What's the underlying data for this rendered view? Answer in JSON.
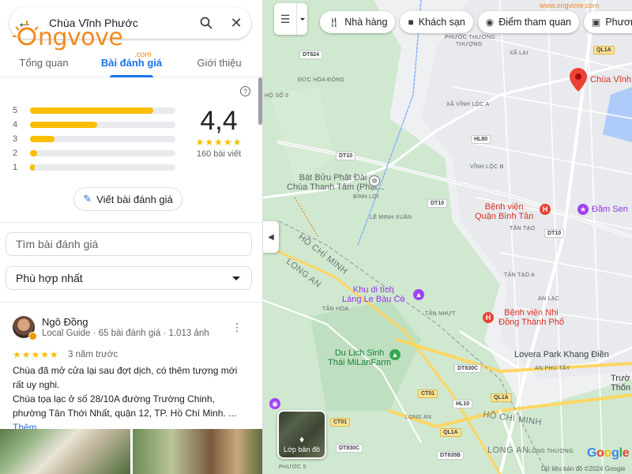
{
  "search": {
    "query": "Chùa Vĩnh Phước"
  },
  "watermark": {
    "text": "ngvove",
    "suffix": ".com",
    "map_site": "www.ongvove.com"
  },
  "tabs": [
    {
      "label": "Tổng quan"
    },
    {
      "label": "Bài đánh giá"
    },
    {
      "label": "Giới thiệu"
    }
  ],
  "rating": {
    "score": "4,4",
    "count": "160 bài viết",
    "stars": "★★★★★",
    "bars": [
      {
        "label": "5",
        "fraction": 0.85
      },
      {
        "label": "4",
        "fraction": 0.46
      },
      {
        "label": "3",
        "fraction": 0.17
      },
      {
        "label": "2",
        "fraction": 0.05
      },
      {
        "label": "1",
        "fraction": 0.03
      }
    ],
    "write_label": "Viết bài đánh giá"
  },
  "review_search": {
    "placeholder": "Tìm bài đánh giá"
  },
  "sort": {
    "value": "Phù hợp nhất"
  },
  "review": {
    "author": "Ngô Đồng",
    "meta": "Local Guide · 65 bài đánh giá · 1.013 ảnh",
    "stars": "★★★★★",
    "time": "3 năm trước",
    "text1": "Chùa đã mở cửa lại sau đợt dịch, có thêm tượng mới rất uy nghi.",
    "text2": "Chùa tọa lạc ở số 28/10A đường Trường Chinh, phường Tân Thới Nhất, quận 12, TP. Hồ Chí Minh. ...",
    "more": "Thêm"
  },
  "map": {
    "chips": [
      {
        "icon": "restaurant-icon",
        "label": "Nhà hàng"
      },
      {
        "icon": "hotel-icon",
        "label": "Khách sạn"
      },
      {
        "icon": "camera-icon",
        "label": "Điểm tham quan"
      },
      {
        "icon": "transit-icon",
        "label": "Phương tiện"
      }
    ],
    "layers_label": "Lớp bản đồ",
    "footer": "Dữ liệu bản đồ ©2024 Google",
    "pois": {
      "chua_vinh": "Chùa Vĩnh",
      "bat_buu_1": "Bát Bửu Phật Đài -",
      "bat_buu_2": "Chùa Thanh Tâm (Phật...",
      "binh_loi": "BÌNH LỢI",
      "benh_vien_bt_1": "Bệnh viện",
      "benh_vien_bt_2": "Quận Bình Tân",
      "dam_sen": "Đầm Sen",
      "khu_di_tich_1": "Khu di tích",
      "khu_di_tich_2": "Láng Le Bàu Cò",
      "benh_vien_nhi_1": "Bệnh viện Nhi",
      "benh_vien_nhi_2": "Đồng Thành Phố",
      "du_lich_1": "Du Lịch Sinh",
      "du_lich_2": "Thái MiLanFarm",
      "lovera": "Lovera Park Khang Điền",
      "truong_1": "Trườ",
      "truong_2": "Thốn"
    },
    "labels": {
      "phuoc_thuong": "PHƯỚC THƯỜNG",
      "thuong": "THƯỢNG",
      "xa_lai": "XÃ LẠI",
      "duc_hoa_dong": "ĐỨC HÒA ĐÔNG",
      "ho_so_5": "HỘ SỐ 5",
      "xa_vinh_loc_a": "XÃ VĨNH LỘC A",
      "vinh_loc_b": "VĨNH LỘC B",
      "le_minh_xuan": "LÊ MINH XUÂN",
      "tan_tao": "TÂN TẠO",
      "tan_tao_a": "TÂN TẠO A",
      "an_lac": "AN LẠC",
      "tan_hoa": "TÂN HÒA",
      "tan_nhut": "TÂN NHỰT",
      "an_phu_tay": "AN PHÚ TÂY",
      "long_thuong": "LONG THƯỢNG",
      "long_an_small": "LONG AN",
      "phuoc_5": "PHƯỚC 5",
      "hcm_1": "HỒ CHÍ MINH",
      "long_an_1": "LONG AN",
      "hcm_2": "HỒ CHÍ MINH",
      "long_an_2": "LONG AN"
    },
    "roads": {
      "dt824": "DT824",
      "ql1a_a": "QL1A",
      "ql1a_b": "QL1A",
      "ql1a_c": "QL1A",
      "dt10_a": "DT10",
      "dt10_b": "DT10",
      "dt10_c": "DT10",
      "hl80": "HL80",
      "dt830c_a": "DT830C",
      "dt830c_b": "DT830C",
      "ct01_a": "CT01",
      "ct01_b": "CT01",
      "hl10": "HL10",
      "dt835b": "DT835B"
    }
  }
}
